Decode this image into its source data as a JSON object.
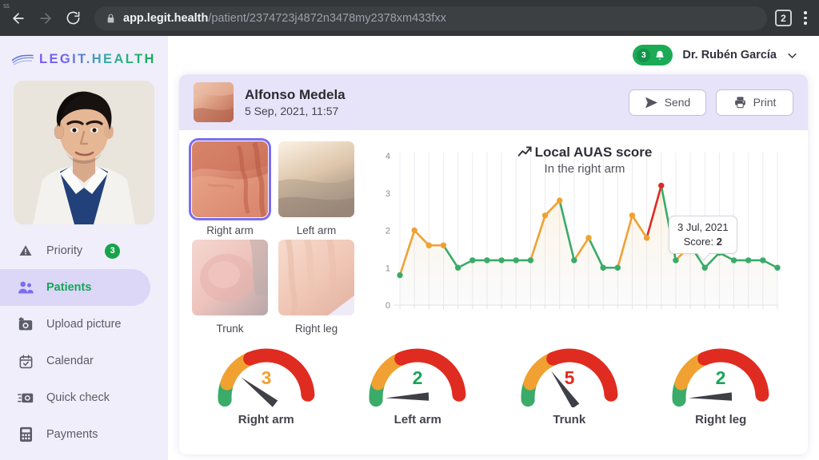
{
  "browser": {
    "back_label": "back",
    "forward_label": "forward",
    "reload_label": "reload",
    "url_host": "app.legit.health",
    "url_path": "/patient/2374723j4872n3478my2378xm433fxx",
    "tab_count": "2",
    "corner_label": "SS"
  },
  "sidebar": {
    "logo_text": "LEGIT.HEALTH",
    "items": [
      {
        "label": "Priority",
        "icon": "warning-icon",
        "badge": "3",
        "active": false
      },
      {
        "label": "Patients",
        "icon": "people-icon",
        "badge": "",
        "active": true
      },
      {
        "label": "Upload picture",
        "icon": "camera-add-icon",
        "badge": "",
        "active": false
      },
      {
        "label": "Calendar",
        "icon": "calendar-icon",
        "badge": "",
        "active": false
      },
      {
        "label": "Quick check",
        "icon": "camera-fast-icon",
        "badge": "",
        "active": false
      },
      {
        "label": "Payments",
        "icon": "calculator-icon",
        "badge": "",
        "active": false
      }
    ]
  },
  "topbar": {
    "notification_count": "3",
    "bell_icon": "bell-icon",
    "doctor_name": "Dr. Rubén García",
    "chevron_icon": "chevron-down-icon"
  },
  "patient": {
    "name": "Alfonso Medela",
    "datetime": "5 Sep, 2021, 11:57",
    "send_label": "Send",
    "send_icon": "paper-plane-icon",
    "print_label": "Print",
    "print_icon": "printer-icon"
  },
  "thumbnails": [
    {
      "label": "Right arm",
      "selected": true
    },
    {
      "label": "Left arm",
      "selected": false
    },
    {
      "label": "Trunk",
      "selected": false
    },
    {
      "label": "Right leg",
      "selected": false
    }
  ],
  "tooltip": {
    "date": "3 Jul, 2021",
    "score_label": "Score:",
    "score_value": "2"
  },
  "gauges": [
    {
      "label": "Right arm",
      "value": "3",
      "color": "#f0a131",
      "needle_angle": 38
    },
    {
      "label": "Left arm",
      "value": "2",
      "color": "#18a558",
      "needle_angle": -2
    },
    {
      "label": "Trunk",
      "value": "5",
      "color": "#e02b20",
      "needle_angle": 55
    },
    {
      "label": "Right leg",
      "value": "2",
      "color": "#18a558",
      "needle_angle": -2
    }
  ],
  "colors": {
    "green": "#3aab69",
    "orange": "#f0a131",
    "red": "#e02b20",
    "purple_accent": "#7b6cf0",
    "sidebar_bg": "#f0eefb"
  },
  "chart_data": {
    "type": "line",
    "title": "Local AUAS score",
    "subtitle": "In the right arm",
    "title_icon": "trend-up-icon",
    "xlabel": "",
    "ylabel": "",
    "ylim": [
      0,
      4
    ],
    "yticks": [
      0,
      1,
      2,
      3,
      4
    ],
    "grid": true,
    "legend": "none",
    "series": [
      {
        "name": "Local AUAS score",
        "values": [
          0.8,
          2.0,
          1.6,
          1.6,
          1.0,
          1.2,
          1.2,
          1.2,
          1.2,
          1.2,
          2.4,
          2.8,
          1.2,
          1.8,
          1.0,
          1.0,
          2.4,
          1.8,
          3.2,
          1.2,
          1.6,
          1.0,
          1.4,
          1.2,
          1.2,
          1.2,
          1.0
        ],
        "point_colors": [
          "green",
          "orange",
          "orange",
          "orange",
          "green",
          "green",
          "green",
          "green",
          "green",
          "green",
          "orange",
          "orange",
          "green",
          "orange",
          "green",
          "green",
          "orange",
          "orange",
          "red",
          "green",
          "orange",
          "green",
          "green",
          "green",
          "green",
          "green",
          "green"
        ]
      }
    ],
    "annotations": [
      {
        "text": "3 Jul, 2021",
        "text2": "Score: 2",
        "point_index": 23
      }
    ]
  }
}
